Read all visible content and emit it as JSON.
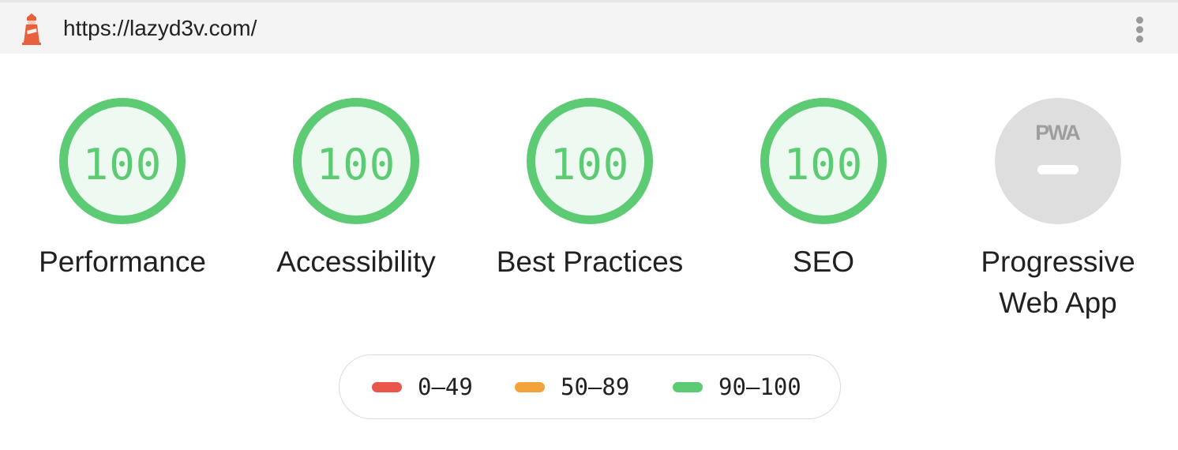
{
  "header": {
    "url": "https://lazyd3v.com/",
    "logo_icon": "lighthouse-icon",
    "menu_icon": "more-vertical-icon"
  },
  "gauges": [
    {
      "label": "Performance",
      "score": "100",
      "color": "#5ccb74"
    },
    {
      "label": "Accessibility",
      "score": "100",
      "color": "#5ccb74"
    },
    {
      "label": "Best Practices",
      "score": "100",
      "color": "#5ccb74"
    },
    {
      "label": "SEO",
      "score": "100",
      "color": "#5ccb74"
    }
  ],
  "pwa": {
    "badge_text": "PWA",
    "label_line1": "Progressive",
    "label_line2": "Web App"
  },
  "legend": [
    {
      "range": "0–49",
      "color": "#e8574a"
    },
    {
      "range": "50–89",
      "color": "#f2a33a"
    },
    {
      "range": "90–100",
      "color": "#5ccb74"
    }
  ]
}
